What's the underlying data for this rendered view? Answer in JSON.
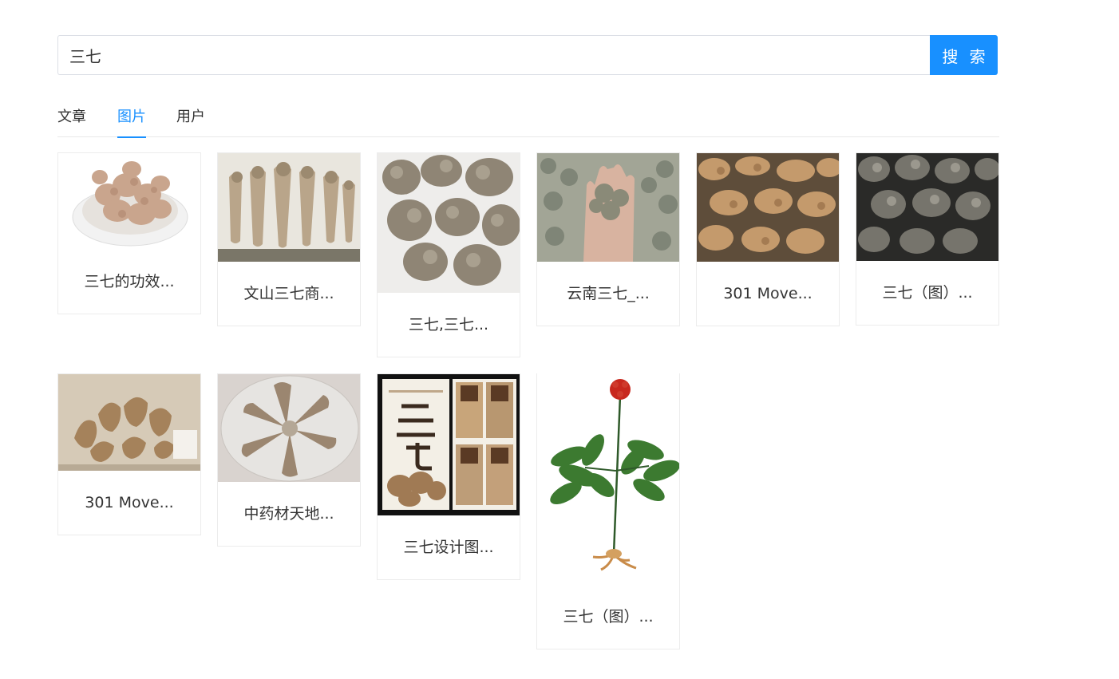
{
  "search": {
    "value": "三七",
    "button_label": "搜 索"
  },
  "tabs": [
    {
      "label": "文章",
      "active": false
    },
    {
      "label": "图片",
      "active": true
    },
    {
      "label": "用户",
      "active": false
    }
  ],
  "accent_color": "#1890ff",
  "results": [
    {
      "caption": "三七的功效...",
      "thumb": "sanqi-roots-in-white-bowl"
    },
    {
      "caption": "文山三七商...",
      "thumb": "sanqi-roots-on-tray"
    },
    {
      "caption": "三七,三七...",
      "thumb": "sanqi-roots-pile-grey"
    },
    {
      "caption": "云南三七_...",
      "thumb": "sanqi-roots-in-hand"
    },
    {
      "caption": "301 Move...",
      "thumb": "sanqi-roots-heap-brown"
    },
    {
      "caption": "三七（图）...",
      "thumb": "sanqi-roots-dark-heap"
    },
    {
      "caption": "301 Move...",
      "thumb": "sanqi-roots-on-table"
    },
    {
      "caption": "中药材天地...",
      "thumb": "sanqi-roots-star-on-plate"
    },
    {
      "caption": "三七设计图...",
      "thumb": "sanqi-poster-design"
    },
    {
      "caption": "三七（图）...",
      "thumb": "sanqi-plant-with-red-berries"
    }
  ]
}
